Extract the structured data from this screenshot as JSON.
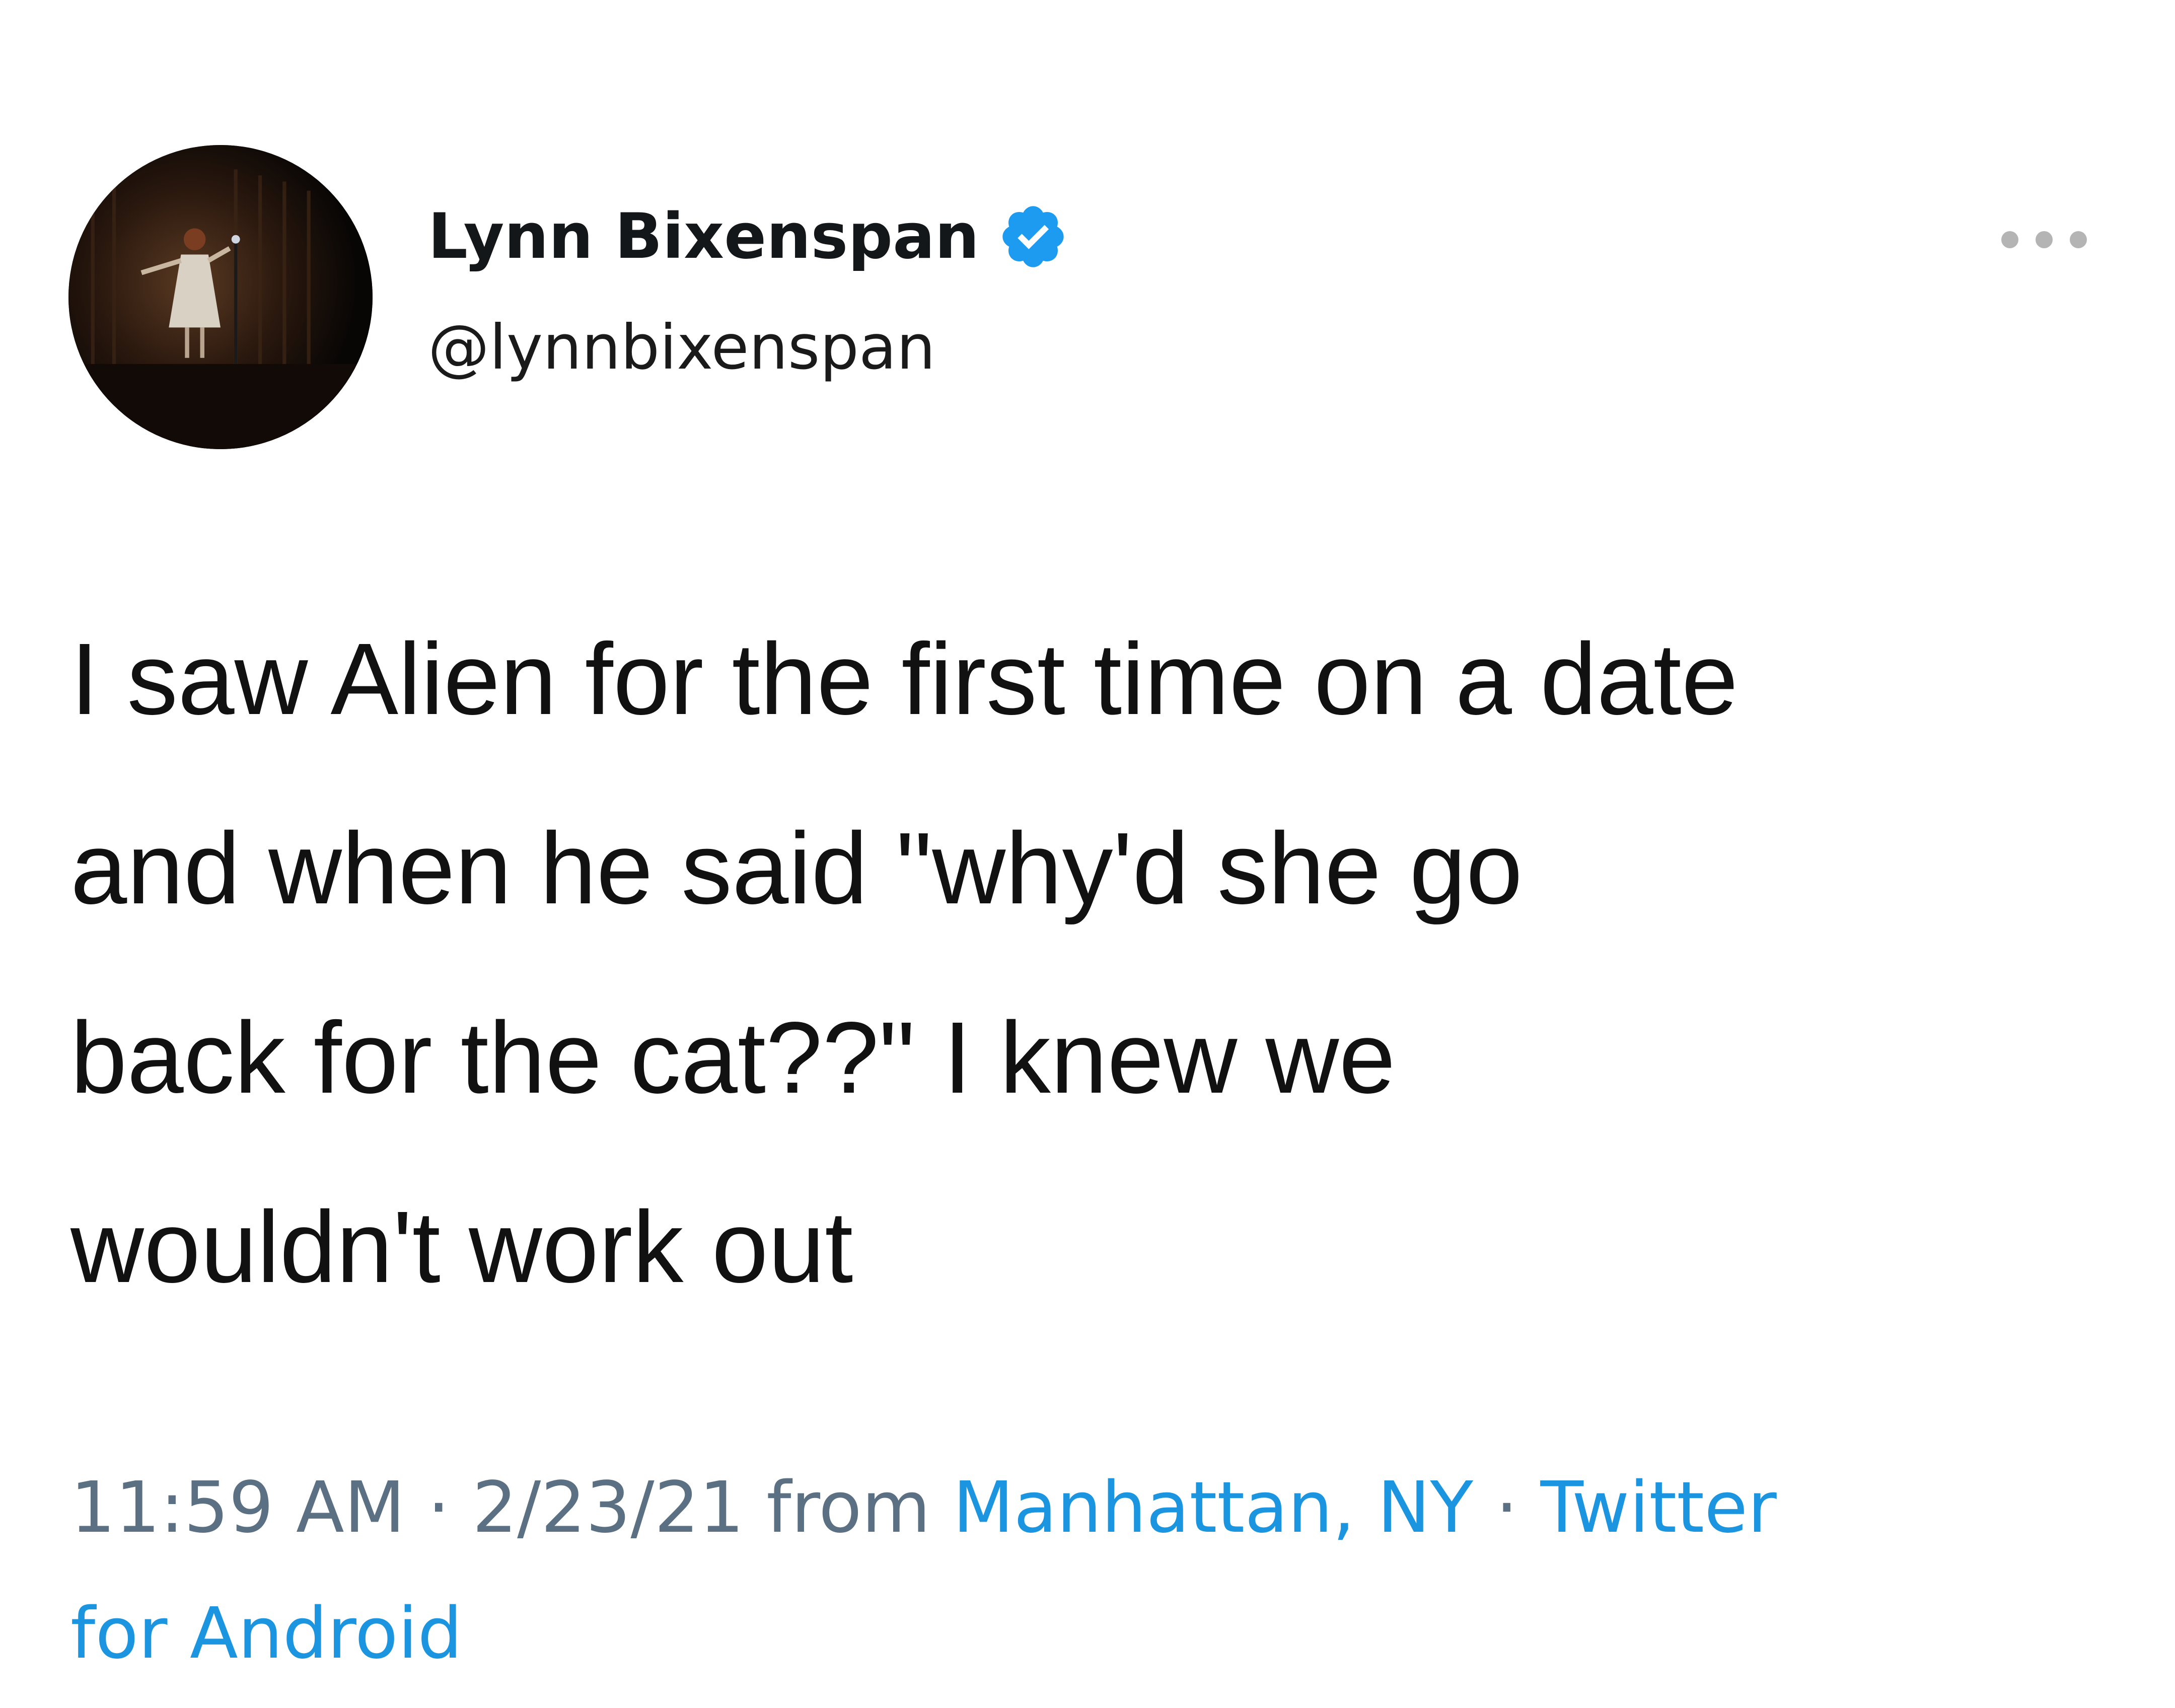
{
  "tweet": {
    "author": {
      "display_name": "Lynn Bixenspan",
      "handle": "@lynnbixenspan",
      "verified": true
    },
    "text_lines": [
      "I saw Alien for the first time on a date",
      "and when he said \"why'd she go",
      "back for the cat??\" I knew we",
      "wouldn't work out"
    ],
    "meta": {
      "time": "11:59 AM",
      "separator": "·",
      "date": "2/23/21",
      "from_label": "from",
      "location": "Manhattan, NY",
      "source_line1": "Twitter",
      "source_line2": "for Android"
    }
  },
  "icons": {
    "avatar": "profile-photo",
    "verified": "verified-badge-icon",
    "more": "more-options-icon"
  },
  "colors": {
    "link": "#1b95e0",
    "meta_gray": "#5b7083",
    "verified_blue": "#1d9bf0",
    "text": "#111111"
  }
}
